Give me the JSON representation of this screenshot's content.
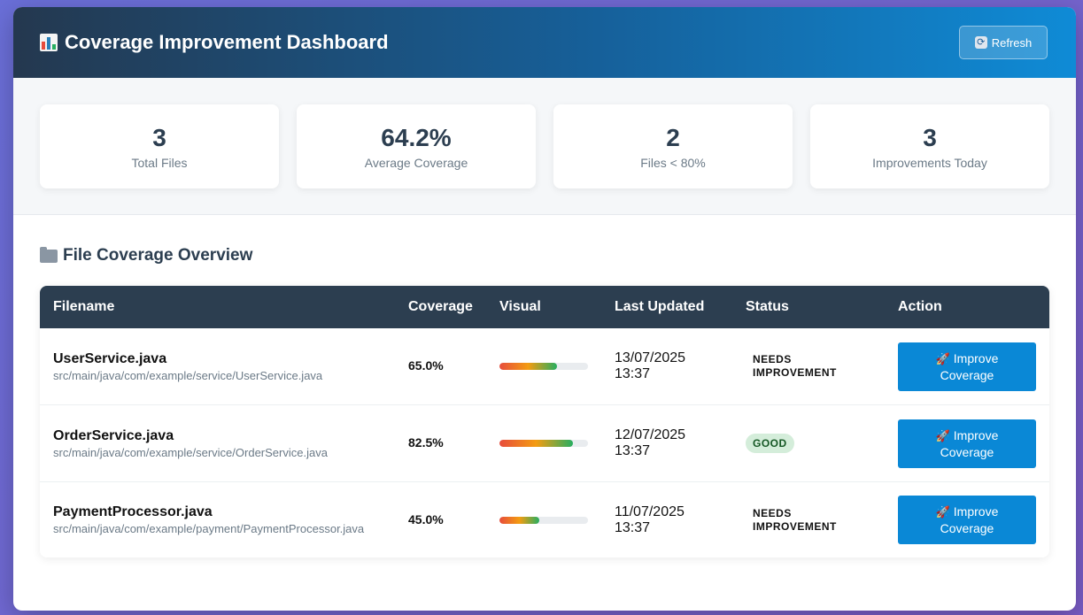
{
  "header": {
    "title": "Coverage Improvement Dashboard",
    "refresh_label": "Refresh"
  },
  "stats": [
    {
      "value": "3",
      "label": "Total Files"
    },
    {
      "value": "64.2%",
      "label": "Average Coverage"
    },
    {
      "value": "2",
      "label": "Files < 80%"
    },
    {
      "value": "3",
      "label": "Improvements Today"
    }
  ],
  "section": {
    "title": "File Coverage Overview"
  },
  "table": {
    "columns": [
      "Filename",
      "Coverage",
      "Visual",
      "Last Updated",
      "Status",
      "Action"
    ],
    "rows": [
      {
        "name": "UserService.java",
        "path": "src/main/java/com/example/service/UserService.java",
        "coverage": "65.0%",
        "coverage_fraction": 0.65,
        "date": "13/07/2025",
        "time": "13:37",
        "status_line1": "NEEDS",
        "status_line2": "IMPROVEMENT",
        "action_line1": "Improve",
        "action_line2": "Coverage"
      },
      {
        "name": "OrderService.java",
        "path": "src/main/java/com/example/service/OrderService.java",
        "coverage": "82.5%",
        "coverage_fraction": 0.825,
        "date": "12/07/2025",
        "time": "13:37",
        "status": "GOOD",
        "action_line1": "Improve",
        "action_line2": "Coverage"
      },
      {
        "name": "PaymentProcessor.java",
        "path": "src/main/java/com/example/payment/PaymentProcessor.java",
        "coverage": "45.0%",
        "coverage_fraction": 0.45,
        "date": "11/07/2025",
        "time": "13:37",
        "status_line1": "NEEDS",
        "status_line2": "IMPROVEMENT",
        "action_line1": "Improve",
        "action_line2": "Coverage"
      }
    ]
  },
  "colors": {
    "header_start": "#24384f",
    "header_end": "#0f8bd6",
    "table_header": "#2c3e50",
    "action_button": "#0a88d6",
    "good_badge_bg": "#d4edda",
    "good_badge_text": "#155724"
  },
  "icons": {
    "title": "bar-chart-icon",
    "refresh": "refresh-icon",
    "section": "folder-icon",
    "action": "rocket-icon"
  }
}
